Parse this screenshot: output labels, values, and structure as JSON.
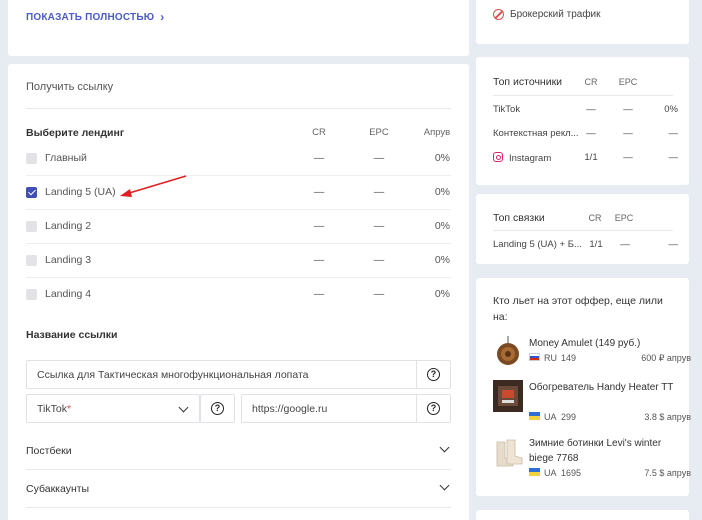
{
  "top_card": {
    "show_all": "ПОКАЗАТЬ ПОЛНОСТЬЮ"
  },
  "get_link": {
    "title": "Получить ссылку",
    "choose_landing": "Выберите лендинг",
    "columns": {
      "cr": "CR",
      "epc": "EPC",
      "approve": "Апрув"
    },
    "landings": [
      {
        "name": "Главный",
        "checked": false,
        "cr": "—",
        "epc": "—",
        "approve": "0%"
      },
      {
        "name": "Landing 5 (UA)",
        "checked": true,
        "cr": "—",
        "epc": "—",
        "approve": "0%"
      },
      {
        "name": "Landing 2",
        "checked": false,
        "cr": "—",
        "epc": "—",
        "approve": "0%"
      },
      {
        "name": "Landing 3",
        "checked": false,
        "cr": "—",
        "epc": "—",
        "approve": "0%"
      },
      {
        "name": "Landing 4",
        "checked": false,
        "cr": "—",
        "epc": "—",
        "approve": "0%"
      }
    ],
    "link_name_title": "Название ссылки",
    "link_name_value": "Ссылка для Тактическая многофункциональная лопата",
    "source_select": "TikTok",
    "source_required": "*",
    "url_value": "https://google.ru",
    "help_glyph": "?",
    "postbacks": "Постбеки",
    "subaccounts": "Субаккаунты"
  },
  "broker_card": {
    "label": "Брокерский трафик"
  },
  "top_sources": {
    "title": "Топ источники",
    "columns": {
      "cr": "CR",
      "epc": "EPC"
    },
    "rows": [
      {
        "name": "TikTok",
        "cr": "—",
        "epc": "—",
        "extra": "0%"
      },
      {
        "name": "Контекстная рекл...",
        "cr": "—",
        "epc": "—",
        "extra": "—"
      },
      {
        "name": "Instagram",
        "cr": "1/1",
        "epc": "—",
        "extra": "—",
        "icon": "instagram-icon"
      }
    ]
  },
  "top_bundles": {
    "title": "Топ связки",
    "columns": {
      "cr": "CR",
      "epc": "EPC"
    },
    "rows": [
      {
        "name": "Landing 5 (UA) + Б...",
        "cr": "1/1",
        "epc": "—",
        "extra": "—"
      }
    ]
  },
  "also_poured": {
    "title": "Кто льет на этот оффер, еще лили на:",
    "offers": [
      {
        "name": "Money Amulet (149 руб.)",
        "geo": "RU",
        "count": "149",
        "payout": "600 ₽ апрув",
        "thumb": "amulet-thumb"
      },
      {
        "name": "Обогреватель Handy Heater TT",
        "geo": "UA",
        "count": "299",
        "payout": "3.8 $ апрув",
        "thumb": "heater-thumb"
      },
      {
        "name": "Зимние ботинки Levi's winter biege 7768",
        "geo": "UA",
        "count": "1695",
        "payout": "7.5 $ апрув",
        "thumb": "boots-thumb"
      }
    ]
  },
  "colors": {
    "accent": "#4a5cc7",
    "checkbox": "#3f4fb4",
    "arrow": "#e02020",
    "background": "#e7ebf2"
  }
}
